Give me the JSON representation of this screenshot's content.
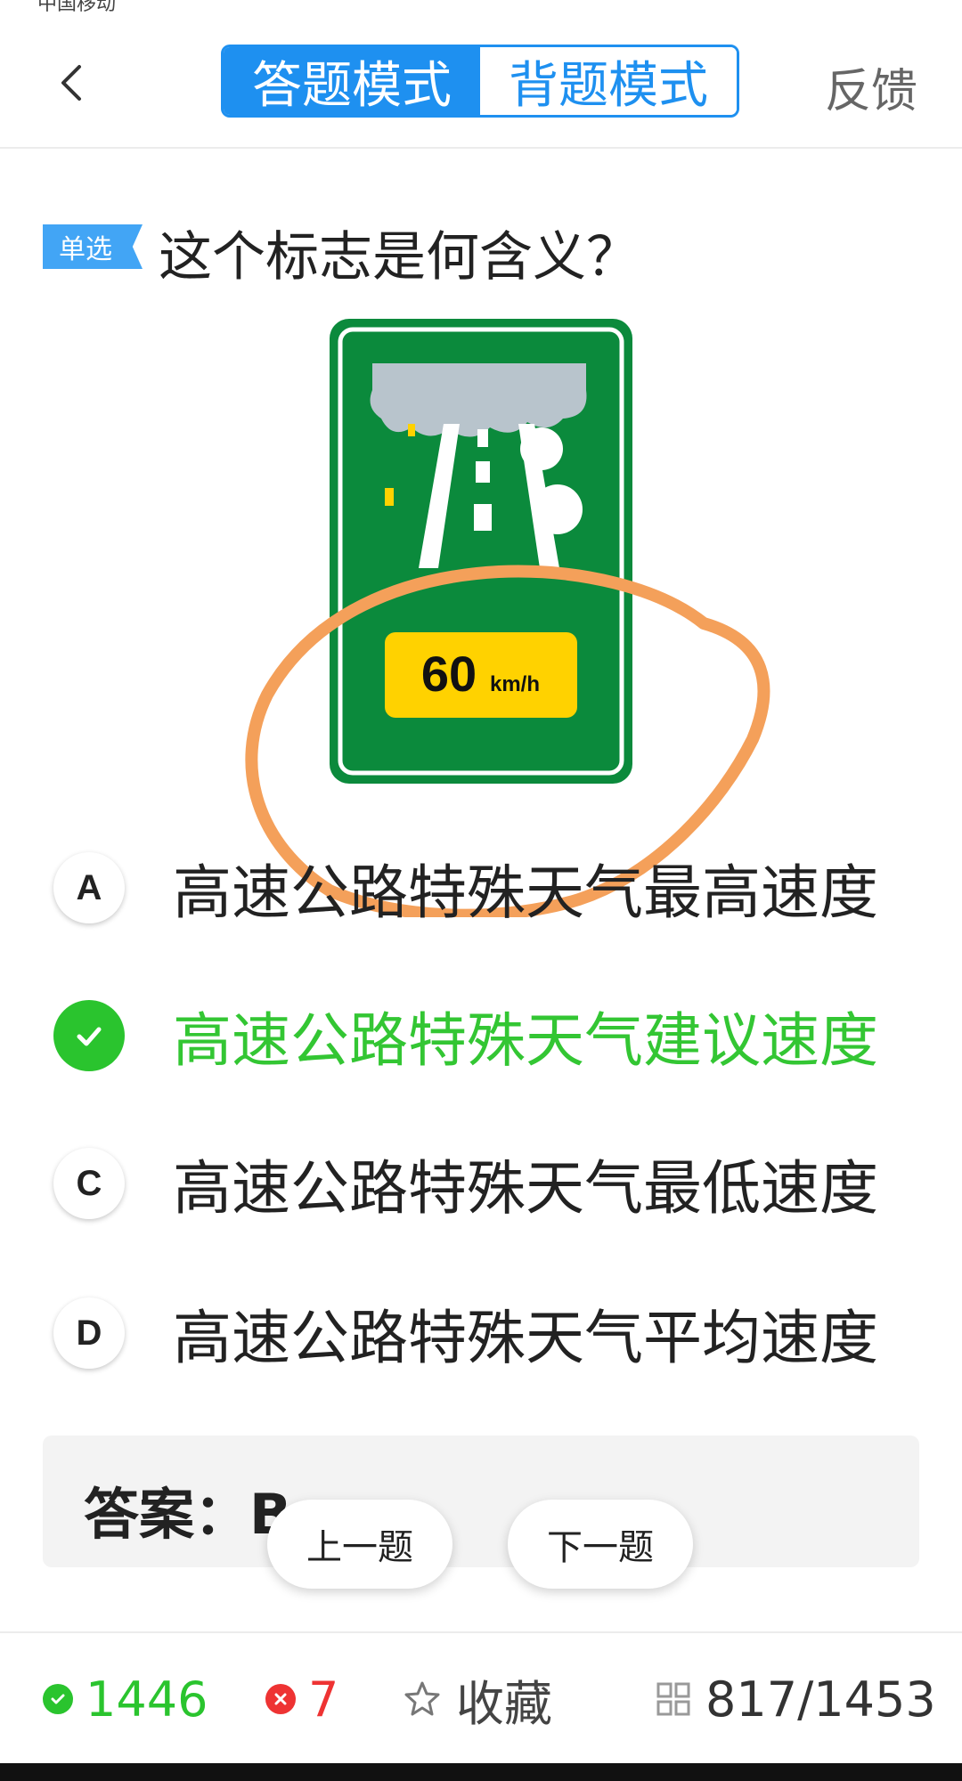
{
  "status_bar": {
    "carrier": "中国移动"
  },
  "header": {
    "tabs": [
      {
        "label": "答题模式",
        "active": true
      },
      {
        "label": "背题模式",
        "active": false
      }
    ],
    "feedback_label": "反馈"
  },
  "question": {
    "type_tag": "单选",
    "text": "这个标志是何含义？",
    "sign": {
      "speed": "60",
      "unit": "km/h"
    }
  },
  "options": [
    {
      "letter": "A",
      "text": "高速公路特殊天气最高速度",
      "correct": false
    },
    {
      "letter": "B",
      "text": "高速公路特殊天气建议速度",
      "correct": true
    },
    {
      "letter": "C",
      "text": "高速公路特殊天气最低速度",
      "correct": false
    },
    {
      "letter": "D",
      "text": "高速公路特殊天气平均速度",
      "correct": false
    }
  ],
  "answer": {
    "text": "答案：B"
  },
  "nav": {
    "prev_label": "上一题",
    "next_label": "下一题"
  },
  "stats": {
    "correct_count": "1446",
    "wrong_count": "7",
    "favorite_label": "收藏",
    "progress": "817/1453"
  },
  "colors": {
    "accent": "#1e90f0",
    "correct": "#2ac42e",
    "wrong": "#ee3333",
    "sign_green": "#0b8a3c",
    "sign_yellow": "#ffd200",
    "annotation_orange": "#f4a05a"
  }
}
